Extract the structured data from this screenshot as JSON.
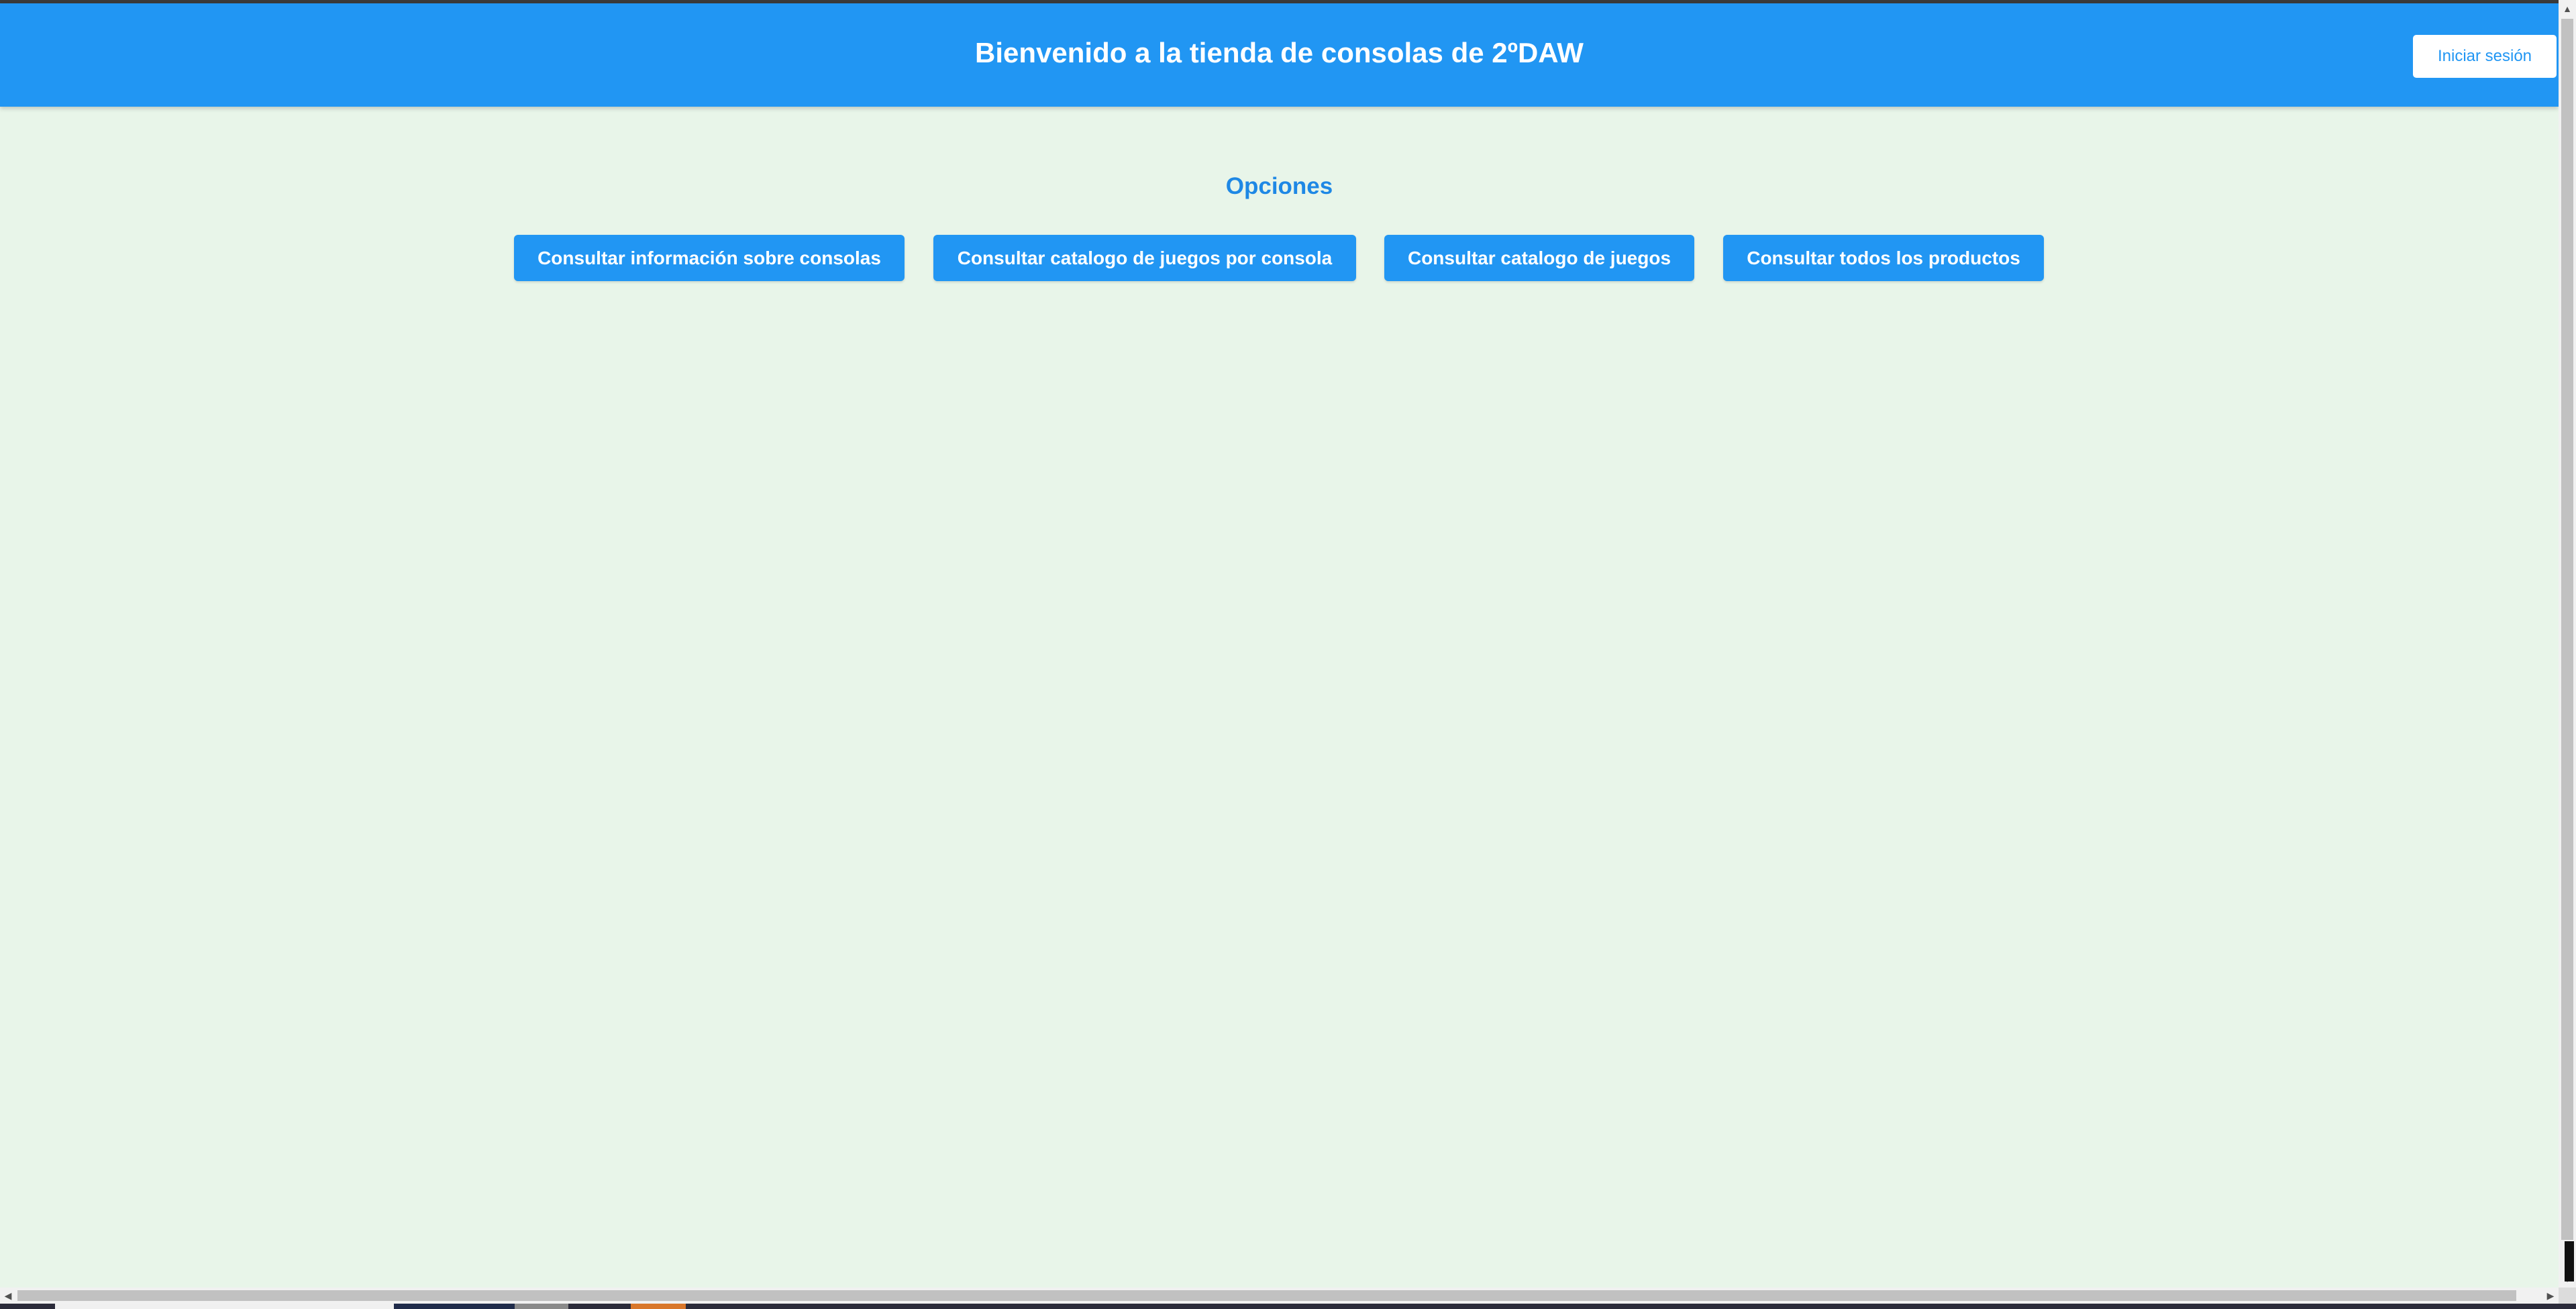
{
  "header": {
    "title": "Bienvenido a la tienda de consolas de 2ºDAW",
    "login_label": "Iniciar sesión"
  },
  "options": {
    "title": "Opciones",
    "buttons": [
      {
        "label": "Consultar información sobre consolas"
      },
      {
        "label": "Consultar catalogo de juegos por consola"
      },
      {
        "label": "Consultar catalogo de juegos"
      },
      {
        "label": "Consultar todos los productos"
      }
    ]
  },
  "icons": {
    "scroll_up": "arrow-up-icon",
    "scroll_down": "arrow-down-icon",
    "scroll_left": "arrow-left-icon",
    "scroll_right": "arrow-right-icon"
  },
  "colors": {
    "header_bg": "#2196f3",
    "page_bg": "#e8f5e9",
    "accent_text": "#1e88e5",
    "button_bg": "#2196f3",
    "button_text": "#ffffff"
  }
}
